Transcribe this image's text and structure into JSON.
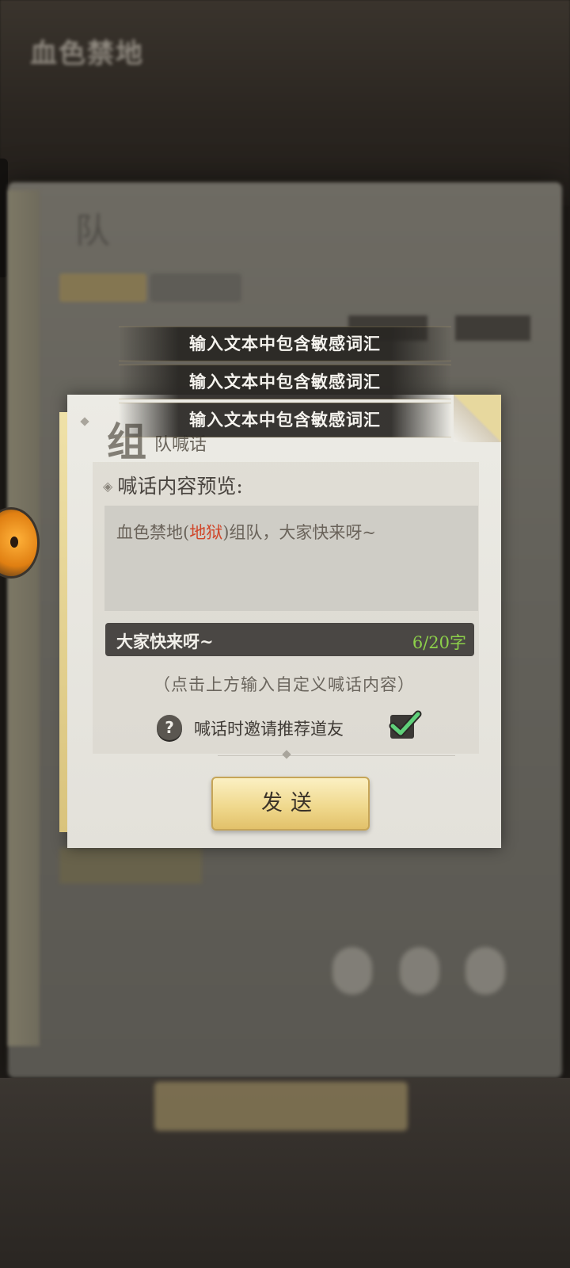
{
  "background": {
    "logo_text": "血色禁地",
    "bg_title": "队"
  },
  "dialog": {
    "title_big": "组",
    "title_small": "队喊话",
    "preview_label": "喊话内容预览:",
    "preview": {
      "prefix": "血色禁地(",
      "highlight": "地狱",
      "suffix": ")组队，大家快来呀~",
      "highlight_color": "#d0462a"
    },
    "input": {
      "value": "大家快来呀~",
      "count": "6/20字"
    },
    "hint": "（点击上方输入自定义喊话内容）",
    "invite": {
      "help_icon": "?",
      "label": "喊话时邀请推荐道友",
      "checked": true
    },
    "send_label": "发送"
  },
  "toasts": [
    "输入文本中包含敏感词汇",
    "输入文本中包含敏感词汇",
    "输入文本中包含敏感词汇"
  ]
}
